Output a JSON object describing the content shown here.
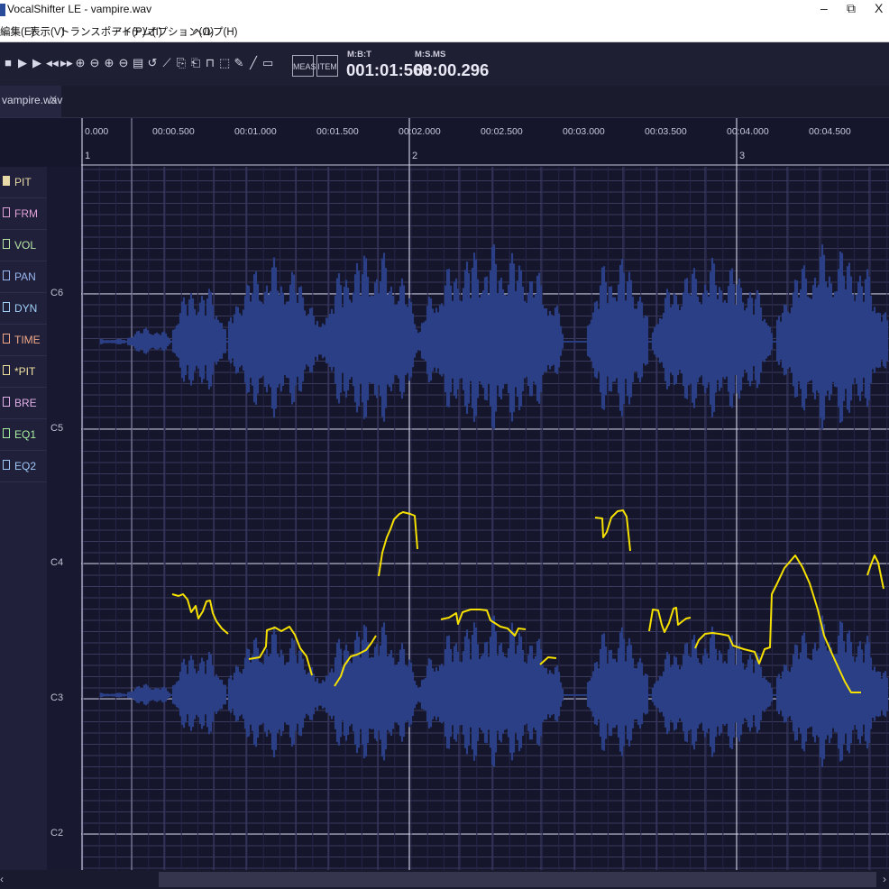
{
  "app": {
    "title": "VocalShifter LE - vampire.wav",
    "minimize": "–",
    "restore": "⧉",
    "close": "X"
  },
  "menu": [
    "編集(E)",
    "表示(V)",
    "トランスポート(P)",
    "アイテム(I)",
    "オプション(O)",
    "ヘルプ(H)"
  ],
  "toolbar": {
    "icons": [
      "stop-icon",
      "play-icon",
      "play-from-start-icon",
      "rewind-icon",
      "fast-forward-icon",
      "zoom-in-horizontal-icon",
      "zoom-out-horizontal-icon",
      "zoom-in-vertical-icon",
      "zoom-out-vertical-icon",
      "scrub-icon",
      "loop-icon",
      "pen-icon",
      "copy-icon",
      "paste-icon",
      "comment-icon",
      "select-tool-icon",
      "pencil-tool-icon",
      "line-tool-icon",
      "rectangle-tool-icon"
    ],
    "meas_label": "MEAS",
    "item_label": "ITEM",
    "mbt_label": "M:B:T",
    "mbt_value": "001:01:568",
    "sms_label": "M:S.MS",
    "sms_value": "00:00.296"
  },
  "tab": {
    "label": "vampire.wav",
    "close": "X"
  },
  "ruler": {
    "time_labels": [
      "0.000",
      "00:00.500",
      "00:01.000",
      "00:01.500",
      "00:02.000",
      "00:02.500",
      "00:03.000",
      "00:03.500",
      "00:04.000",
      "00:04.500"
    ],
    "measures": [
      "1",
      "2",
      "3"
    ]
  },
  "sidebar": [
    {
      "label": "PIT",
      "color": "#e8d9a8",
      "checked": true
    },
    {
      "label": "FRM",
      "color": "#e0a0d8",
      "checked": false
    },
    {
      "label": "VOL",
      "color": "#b8e8a8",
      "checked": false
    },
    {
      "label": "PAN",
      "color": "#9ab8f0",
      "checked": false
    },
    {
      "label": "DYN",
      "color": "#a0d0f8",
      "checked": false
    },
    {
      "label": "TIME",
      "color": "#f0a888",
      "checked": false
    },
    {
      "label": "*PIT",
      "color": "#f0e0a0",
      "checked": false
    },
    {
      "label": "BRE",
      "color": "#e0b0e8",
      "checked": false
    },
    {
      "label": "EQ1",
      "color": "#a8f0a0",
      "checked": false
    },
    {
      "label": "EQ2",
      "color": "#a0c8f8",
      "checked": false
    }
  ],
  "notes": [
    "C6",
    "C5",
    "C4",
    "C3",
    "C2"
  ],
  "colors": {
    "background": "#15152b",
    "waveform": "#2a3f85",
    "pitch_curve": "#f5e000",
    "grid": "#3a3a5c"
  },
  "scrollbar": {
    "left_arrow": "‹",
    "right_arrow": "›"
  }
}
